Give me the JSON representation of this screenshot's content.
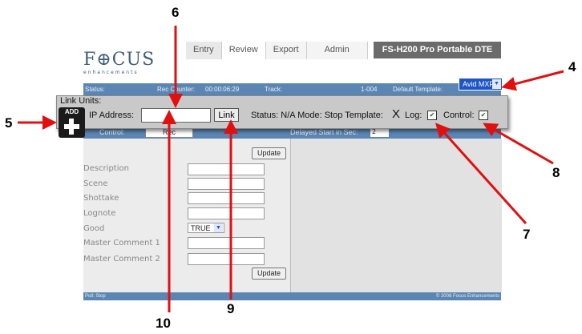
{
  "header": {
    "logo": "F⊕CUS",
    "logo_sub": "enhancements",
    "tabs": [
      "Entry",
      "Review",
      "Export",
      "Admin"
    ],
    "product_title": "FS-H200 Pro Portable DTE"
  },
  "statusbar": {
    "status_label": "Status:",
    "rec_counter_label": "Rec Counter:",
    "rec_counter_value": "00:00:06:29",
    "track_label": "Track:",
    "track_value": "1-004",
    "default_template_label": "Default Template:",
    "default_template_value": "Avid MXF"
  },
  "link_units": {
    "title": "Link Units:",
    "add_label": "ADD",
    "ip_label": "IP Address:",
    "ip_value": "",
    "link_button": "Link",
    "status_text": "Status: N/A  Mode:  Stop  Template:",
    "template_mark": "X",
    "log_label": "Log:",
    "log_checked": true,
    "control_label": "Control:",
    "control_checked": true
  },
  "control_bar": {
    "control_label": "Control:",
    "rec_button": "Rec",
    "delay_label": "Delayed Start in Sec:",
    "delay_value": "2"
  },
  "form": {
    "update_label": "Update",
    "fields": [
      {
        "label": "Description",
        "value": ""
      },
      {
        "label": "Scene",
        "value": ""
      },
      {
        "label": "Shottake",
        "value": ""
      },
      {
        "label": "Lognote",
        "value": ""
      },
      {
        "label": "Good",
        "value": "TRUE"
      },
      {
        "label": "Master Comment 1",
        "value": ""
      },
      {
        "label": "Master Comment 2",
        "value": ""
      }
    ]
  },
  "footer": {
    "left": "Poll: Stop",
    "right": "© 2008 Focus Enhancements"
  },
  "callouts": [
    "4",
    "5",
    "6",
    "7",
    "8",
    "9",
    "10"
  ],
  "colors": {
    "callout_arrow": "#e01010",
    "bar_blue": "#5b86b3",
    "select_blue": "#1d56c4",
    "product_bar": "#6b6b6b"
  }
}
